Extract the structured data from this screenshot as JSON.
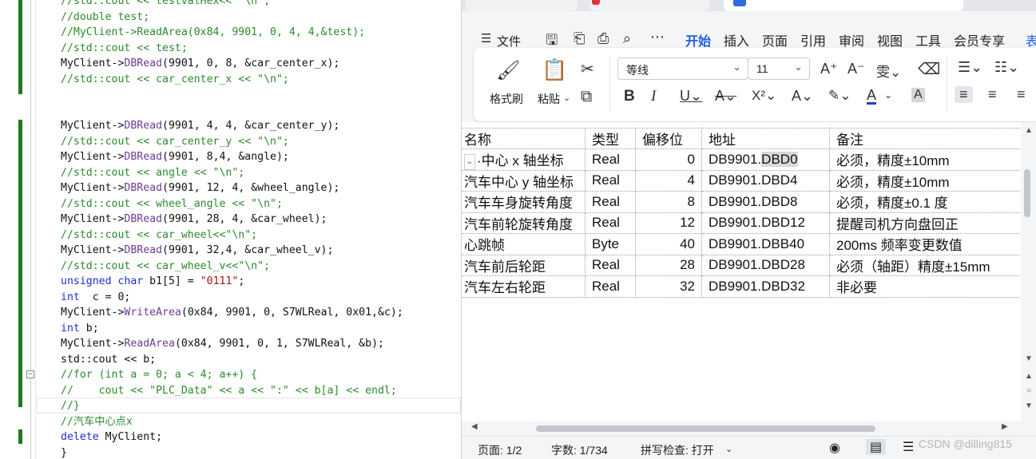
{
  "editor": {
    "lines": [
      [
        [
          "c-com",
          "//std::cout << testvalHex<< \"\\n\";"
        ]
      ],
      [
        [
          "c-com",
          "//double test;"
        ]
      ],
      [
        [
          "c-com",
          "//MyClient->ReadArea(0x84, 9901, 0, 4, 4,&test);"
        ]
      ],
      [
        [
          "c-com",
          "//std::cout << test;"
        ]
      ],
      [
        [
          "",
          "MyClient->"
        ],
        [
          "c-fn",
          "DBRead"
        ],
        [
          "",
          "(9901, 0, 8, &car_center_x);"
        ]
      ],
      [
        [
          "c-com",
          "//std::cout << car_center_x << \"\\n\";"
        ]
      ],
      [
        [
          "",
          ""
        ]
      ],
      [
        [
          "",
          ""
        ]
      ],
      [
        [
          "",
          "MyClient->"
        ],
        [
          "c-fn",
          "DBRead"
        ],
        [
          "",
          "(9901, 4, 4, &car_center_y);"
        ]
      ],
      [
        [
          "c-com",
          "//std::cout << car_center_y << \"\\n\";"
        ]
      ],
      [
        [
          "",
          "MyClient->"
        ],
        [
          "c-fn",
          "DBRead"
        ],
        [
          "",
          "(9901, 8,4, &angle);"
        ]
      ],
      [
        [
          "c-com",
          "//std::cout << angle << \"\\n\";"
        ]
      ],
      [
        [
          "",
          "MyClient->"
        ],
        [
          "c-fn",
          "DBRead"
        ],
        [
          "",
          "(9901, 12, 4, &wheel_angle);"
        ]
      ],
      [
        [
          "c-com",
          "//std::cout << wheel_angle << \"\\n\";"
        ]
      ],
      [
        [
          "",
          "MyClient->"
        ],
        [
          "c-fn",
          "DBRead"
        ],
        [
          "",
          "(9901, 28, 4, &car_wheel);"
        ]
      ],
      [
        [
          "c-com",
          "//std::cout << car_wheel<<\"\\n\";"
        ]
      ],
      [
        [
          "",
          "MyClient->"
        ],
        [
          "c-fn",
          "DBRead"
        ],
        [
          "",
          "(9901, 32,4, &car_wheel_v);"
        ]
      ],
      [
        [
          "c-com",
          "//std::cout << car_wheel_v<<\"\\n\";"
        ]
      ],
      [
        [
          "c-kw",
          "unsigned char"
        ],
        [
          "",
          " b1[5] = "
        ],
        [
          "c-str",
          "\"0111\""
        ],
        [
          "",
          ";"
        ]
      ],
      [
        [
          "c-kw",
          "int"
        ],
        [
          "",
          "  c = 0;"
        ]
      ],
      [
        [
          "",
          "MyClient->"
        ],
        [
          "c-fn",
          "WriteArea"
        ],
        [
          "",
          "(0x84, 9901, 0, S7WLReal, 0x01,&c);"
        ]
      ],
      [
        [
          "c-kw",
          "int"
        ],
        [
          "",
          " b;"
        ]
      ],
      [
        [
          "",
          "MyClient->"
        ],
        [
          "c-fn",
          "ReadArea"
        ],
        [
          "",
          "(0x84, 9901, 0, 1, S7WLReal, &b);"
        ]
      ],
      [
        [
          "",
          "std::cout << b;"
        ]
      ],
      [
        [
          "c-com",
          "//for (int a = 0; a < 4; a++) {"
        ]
      ],
      [
        [
          "c-com",
          "//    cout << \"PLC_Data\" << a << \":\" << b[a] << endl;"
        ]
      ],
      [
        [
          "c-com",
          "//}"
        ]
      ],
      [
        [
          "c-com",
          "//汽车中心点x"
        ]
      ],
      [
        [
          "c-kw",
          "delete"
        ],
        [
          "",
          " MyClient;"
        ]
      ],
      [
        [
          "",
          "}"
        ]
      ]
    ],
    "fold_glyph": "−"
  },
  "wps": {
    "menu": {
      "file": "文件",
      "items": [
        "开始",
        "插入",
        "页面",
        "引用",
        "审阅",
        "视图",
        "工具",
        "会员专享",
        "表"
      ],
      "active": "开始"
    },
    "ribbon": {
      "format_painter": "格式刷",
      "paste": "粘贴",
      "font_name": "等线",
      "font_size": "11"
    },
    "table": {
      "headers": [
        "名称",
        "类型",
        "偏移位",
        "地址",
        "备注"
      ],
      "rows": [
        {
          "name": "·中心 x 轴坐标",
          "type": "Real",
          "offset": "0",
          "addr_prefix": "DB9901.",
          "addr_sel": "DBD0",
          "note": "必须，精度±10mm"
        },
        {
          "name": "汽车中心 y 轴坐标",
          "type": "Real",
          "offset": "4",
          "addr_prefix": "DB9901.DBD4",
          "addr_sel": "",
          "note": "必须，精度±10mm"
        },
        {
          "name": "汽车车身旋转角度",
          "type": "Real",
          "offset": "8",
          "addr_prefix": "DB9901.DBD8",
          "addr_sel": "",
          "note": "必须，精度±0.1 度"
        },
        {
          "name": "汽车前轮旋转角度",
          "type": "Real",
          "offset": "12",
          "addr_prefix": "DB9901.DBD12",
          "addr_sel": "",
          "note": "提醒司机方向盘回正"
        },
        {
          "name": "心跳帧",
          "type": "Byte",
          "offset": "40",
          "addr_prefix": "DB9901.DBB40",
          "addr_sel": "",
          "note": "200ms 频率变更数值"
        },
        {
          "name": "汽车前后轮距",
          "type": "Real",
          "offset": "28",
          "addr_prefix": "DB9901.DBD28",
          "addr_sel": "",
          "note": "必须（轴距）精度±15mm"
        },
        {
          "name": "汽车左右轮距",
          "type": "Real",
          "offset": "32",
          "addr_prefix": "DB9901.DBD32",
          "addr_sel": "",
          "note": "非必要"
        }
      ]
    },
    "status": {
      "page": "页面: 1/2",
      "words": "字数: 1/734",
      "spell": "拼写检查: 打开",
      "watermark": "CSDN @dilling815"
    }
  }
}
